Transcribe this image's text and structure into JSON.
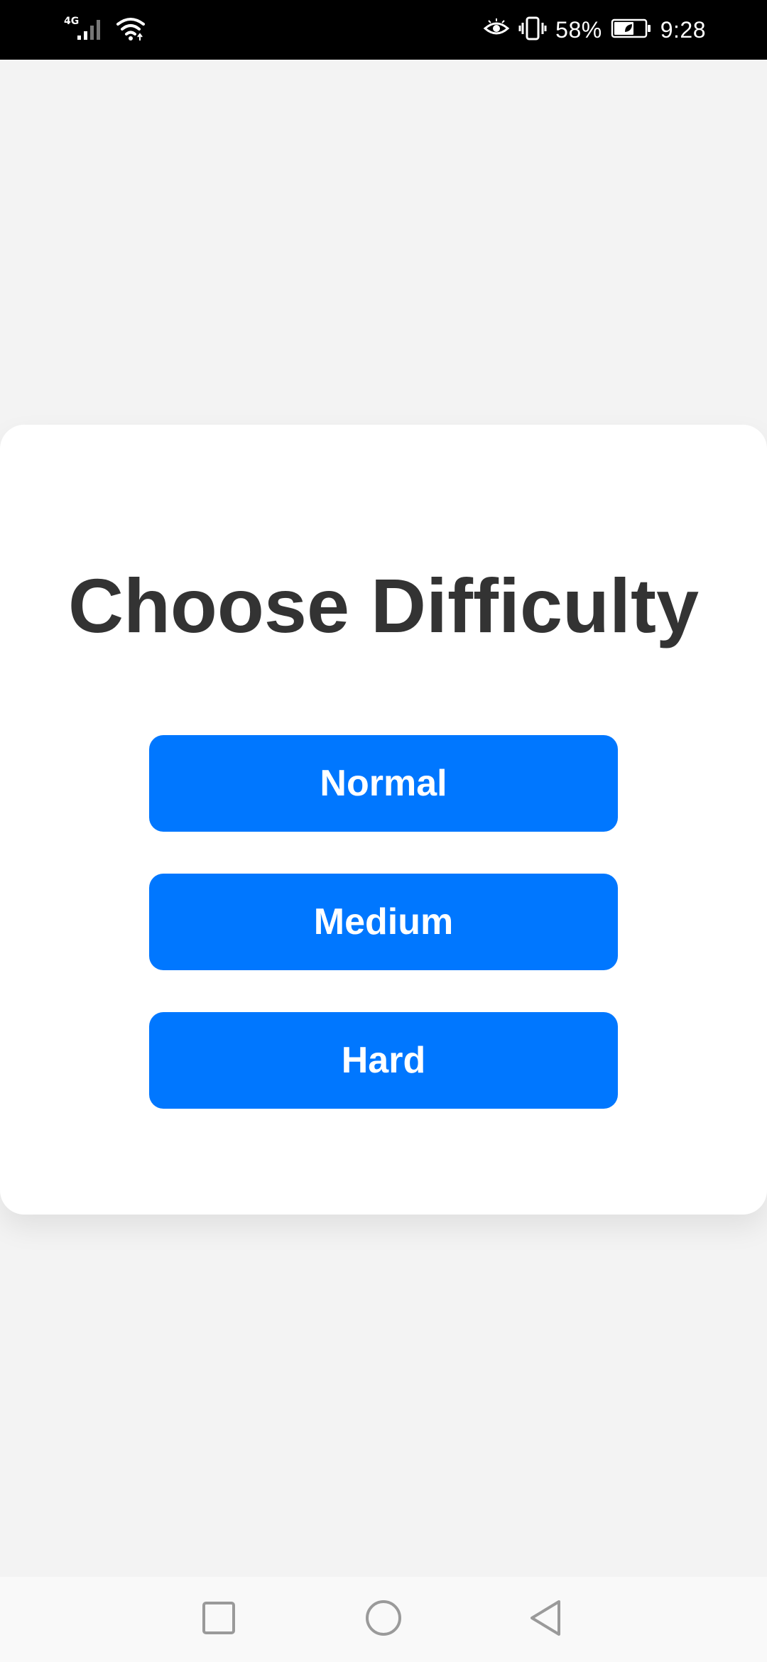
{
  "status_bar": {
    "network_type": "4G",
    "battery_percent": "58%",
    "time": "9:28",
    "icons": [
      "signal-icon",
      "wifi-icon",
      "eye-comfort-icon",
      "vibrate-icon",
      "battery-icon"
    ]
  },
  "dialog": {
    "title": "Choose Difficulty",
    "options": [
      {
        "label": "Normal"
      },
      {
        "label": "Medium"
      },
      {
        "label": "Hard"
      }
    ]
  },
  "colors": {
    "background": "#f3f3f3",
    "card": "#ffffff",
    "title_text": "#333333",
    "button": "#0077ff",
    "button_text": "#ffffff"
  },
  "nav_bar": {
    "icons": [
      "recent-apps-icon",
      "home-icon",
      "back-icon"
    ]
  }
}
